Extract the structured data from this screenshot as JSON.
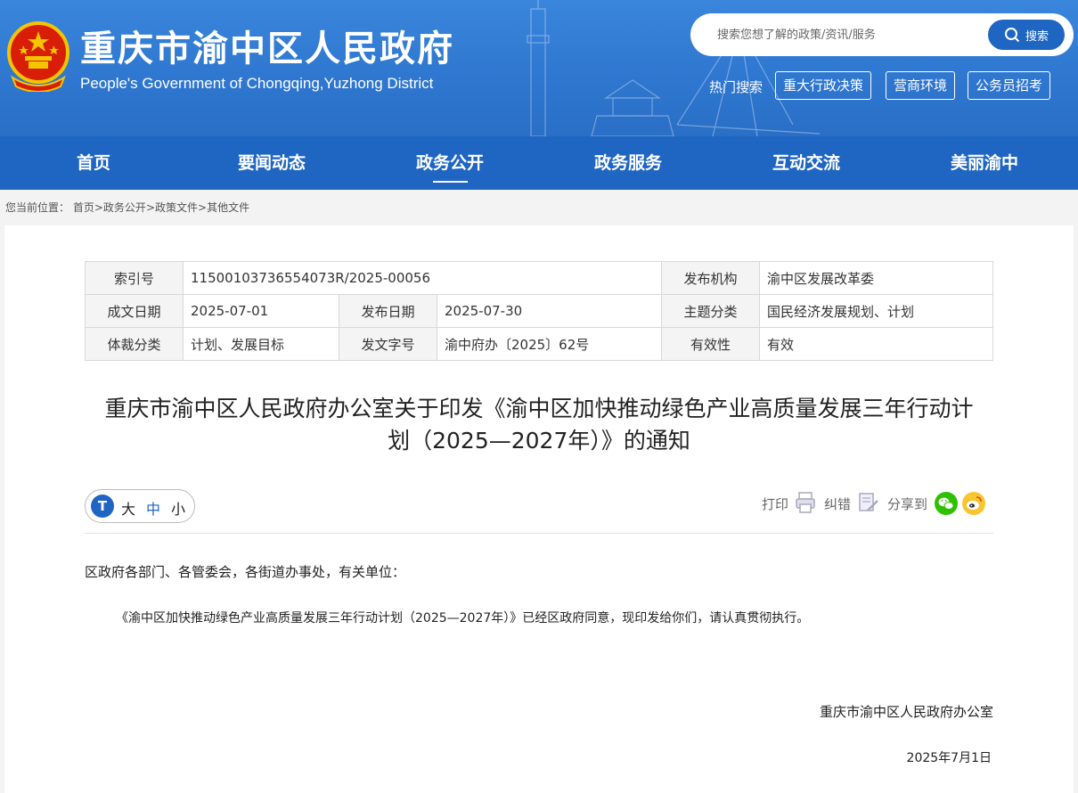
{
  "header": {
    "title": "重庆市渝中区人民政府",
    "subtitle": "People's Government of Chongqing,Yuzhong District",
    "search": {
      "placeholder": "搜索您想了解的政策/资讯/服务",
      "button_label": "搜索"
    },
    "hot_label": "热门搜索",
    "hot_links": [
      "重大行政决策",
      "营商环境",
      "公务员招考"
    ]
  },
  "nav": {
    "items": [
      "首页",
      "要闻动态",
      "政务公开",
      "政务服务",
      "互动交流",
      "美丽渝中"
    ],
    "active": "政务公开"
  },
  "breadcrumb": {
    "prefix": "您当前位置：",
    "items": [
      "首页",
      "政务公开",
      "政策文件",
      "其他文件"
    ],
    "separator": ">"
  },
  "meta_table": {
    "index_no_label": "索引号",
    "index_no": "11500103736554073R/2025-00056",
    "publisher_label": "发布机构",
    "publisher": "渝中区发展改革委",
    "written_date_label": "成文日期",
    "written_date": "2025-07-01",
    "publish_date_label": "发布日期",
    "publish_date": "2025-07-30",
    "topic_label": "主题分类",
    "topic": "国民经济发展规划、计划",
    "genre_label": "体裁分类",
    "genre": "计划、发展目标",
    "doc_no_label": "发文字号",
    "doc_no": "渝中府办〔2025〕62号",
    "validity_label": "有效性",
    "validity": "有效"
  },
  "article": {
    "title_line1": "重庆市渝中区人民政府办公室关于印发《渝中区加快推动绿色产业高质量发展三年行动计",
    "title_line2": "划（2025—2027年）》的通知",
    "salutation": "区政府各部门、各管委会，各街道办事处，有关单位：",
    "body": "《渝中区加快推动绿色产业高质量发展三年行动计划（2025—2027年）》已经区政府同意，现印发给你们，请认真贯彻执行。",
    "signer": "重庆市渝中区人民政府办公室",
    "sign_date": "2025年7月1日"
  },
  "toolbar": {
    "font_icon": "T",
    "font_large": "大",
    "font_medium": "中",
    "font_small": "小",
    "print_label": "打印",
    "correct_label": "纠错",
    "share_label": "分享到"
  },
  "colors": {
    "brand_blue": "#1f66c2",
    "header_blue": "#3a86dc",
    "wechat_green": "#2dc100",
    "weibo_yellow": "#f7c531"
  },
  "icons": {
    "emblem": "national-emblem-icon",
    "search": "search-icon",
    "print": "printer-icon",
    "correct": "error-report-icon",
    "wechat": "wechat-icon",
    "weibo": "weibo-icon"
  }
}
